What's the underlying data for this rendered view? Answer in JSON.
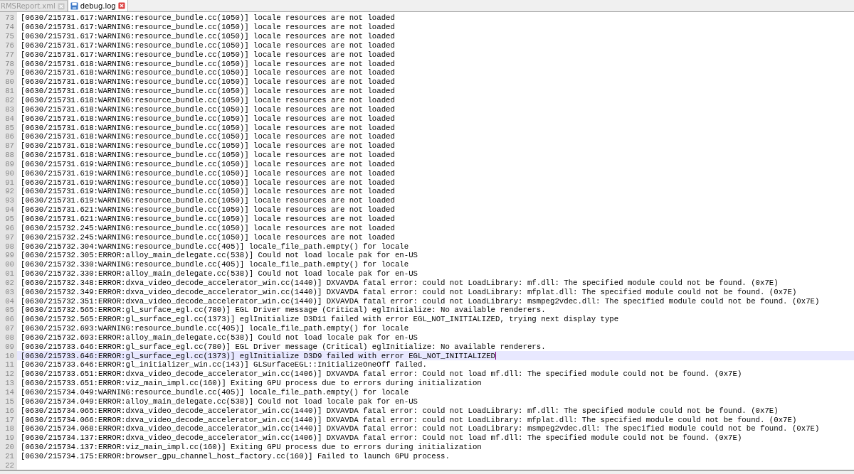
{
  "tabs": [
    {
      "label": "RMSReport.xml",
      "selected": false
    },
    {
      "label": "debug.log",
      "selected": true
    }
  ],
  "editor": {
    "lines": [
      {
        "number": "73",
        "text": "[0630/215731.617:WARNING:resource_bundle.cc(1050)] locale resources are not loaded",
        "current": false
      },
      {
        "number": "74",
        "text": "[0630/215731.617:WARNING:resource_bundle.cc(1050)] locale resources are not loaded",
        "current": false
      },
      {
        "number": "75",
        "text": "[0630/215731.617:WARNING:resource_bundle.cc(1050)] locale resources are not loaded",
        "current": false
      },
      {
        "number": "76",
        "text": "[0630/215731.617:WARNING:resource_bundle.cc(1050)] locale resources are not loaded",
        "current": false
      },
      {
        "number": "77",
        "text": "[0630/215731.617:WARNING:resource_bundle.cc(1050)] locale resources are not loaded",
        "current": false
      },
      {
        "number": "78",
        "text": "[0630/215731.618:WARNING:resource_bundle.cc(1050)] locale resources are not loaded",
        "current": false
      },
      {
        "number": "79",
        "text": "[0630/215731.618:WARNING:resource_bundle.cc(1050)] locale resources are not loaded",
        "current": false
      },
      {
        "number": "80",
        "text": "[0630/215731.618:WARNING:resource_bundle.cc(1050)] locale resources are not loaded",
        "current": false
      },
      {
        "number": "81",
        "text": "[0630/215731.618:WARNING:resource_bundle.cc(1050)] locale resources are not loaded",
        "current": false
      },
      {
        "number": "82",
        "text": "[0630/215731.618:WARNING:resource_bundle.cc(1050)] locale resources are not loaded",
        "current": false
      },
      {
        "number": "83",
        "text": "[0630/215731.618:WARNING:resource_bundle.cc(1050)] locale resources are not loaded",
        "current": false
      },
      {
        "number": "84",
        "text": "[0630/215731.618:WARNING:resource_bundle.cc(1050)] locale resources are not loaded",
        "current": false
      },
      {
        "number": "85",
        "text": "[0630/215731.618:WARNING:resource_bundle.cc(1050)] locale resources are not loaded",
        "current": false
      },
      {
        "number": "86",
        "text": "[0630/215731.618:WARNING:resource_bundle.cc(1050)] locale resources are not loaded",
        "current": false
      },
      {
        "number": "87",
        "text": "[0630/215731.618:WARNING:resource_bundle.cc(1050)] locale resources are not loaded",
        "current": false
      },
      {
        "number": "88",
        "text": "[0630/215731.618:WARNING:resource_bundle.cc(1050)] locale resources are not loaded",
        "current": false
      },
      {
        "number": "89",
        "text": "[0630/215731.619:WARNING:resource_bundle.cc(1050)] locale resources are not loaded",
        "current": false
      },
      {
        "number": "90",
        "text": "[0630/215731.619:WARNING:resource_bundle.cc(1050)] locale resources are not loaded",
        "current": false
      },
      {
        "number": "91",
        "text": "[0630/215731.619:WARNING:resource_bundle.cc(1050)] locale resources are not loaded",
        "current": false
      },
      {
        "number": "92",
        "text": "[0630/215731.619:WARNING:resource_bundle.cc(1050)] locale resources are not loaded",
        "current": false
      },
      {
        "number": "93",
        "text": "[0630/215731.619:WARNING:resource_bundle.cc(1050)] locale resources are not loaded",
        "current": false
      },
      {
        "number": "94",
        "text": "[0630/215731.621:WARNING:resource_bundle.cc(1050)] locale resources are not loaded",
        "current": false
      },
      {
        "number": "95",
        "text": "[0630/215731.621:WARNING:resource_bundle.cc(1050)] locale resources are not loaded",
        "current": false
      },
      {
        "number": "96",
        "text": "[0630/215732.245:WARNING:resource_bundle.cc(1050)] locale resources are not loaded",
        "current": false
      },
      {
        "number": "97",
        "text": "[0630/215732.245:WARNING:resource_bundle.cc(1050)] locale resources are not loaded",
        "current": false
      },
      {
        "number": "98",
        "text": "[0630/215732.304:WARNING:resource_bundle.cc(405)] locale_file_path.empty() for locale",
        "current": false
      },
      {
        "number": "99",
        "text": "[0630/215732.305:ERROR:alloy_main_delegate.cc(538)] Could not load locale pak for en-US",
        "current": false
      },
      {
        "number": "00",
        "text": "[0630/215732.330:WARNING:resource_bundle.cc(405)] locale_file_path.empty() for locale",
        "current": false
      },
      {
        "number": "01",
        "text": "[0630/215732.330:ERROR:alloy_main_delegate.cc(538)] Could not load locale pak for en-US",
        "current": false
      },
      {
        "number": "02",
        "text": "[0630/215732.348:ERROR:dxva_video_decode_accelerator_win.cc(1440)] DXVAVDA fatal error: could not LoadLibrary: mf.dll: The specified module could not be found. (0x7E)",
        "current": false
      },
      {
        "number": "03",
        "text": "[0630/215732.349:ERROR:dxva_video_decode_accelerator_win.cc(1440)] DXVAVDA fatal error: could not LoadLibrary: mfplat.dll: The specified module could not be found. (0x7E)",
        "current": false
      },
      {
        "number": "04",
        "text": "[0630/215732.351:ERROR:dxva_video_decode_accelerator_win.cc(1440)] DXVAVDA fatal error: could not LoadLibrary: msmpeg2vdec.dll: The specified module could not be found. (0x7E)",
        "current": false
      },
      {
        "number": "05",
        "text": "[0630/215732.565:ERROR:gl_surface_egl.cc(780)] EGL Driver message (Critical) eglInitialize: No available renderers.",
        "current": false
      },
      {
        "number": "06",
        "text": "[0630/215732.565:ERROR:gl_surface_egl.cc(1373)] eglInitialize D3D11 failed with error EGL_NOT_INITIALIZED, trying next display type",
        "current": false
      },
      {
        "number": "07",
        "text": "[0630/215732.693:WARNING:resource_bundle.cc(405)] locale_file_path.empty() for locale",
        "current": false
      },
      {
        "number": "08",
        "text": "[0630/215732.693:ERROR:alloy_main_delegate.cc(538)] Could not load locale pak for en-US",
        "current": false
      },
      {
        "number": "09",
        "text": "[0630/215733.646:ERROR:gl_surface_egl.cc(780)] EGL Driver message (Critical) eglInitialize: No available renderers.",
        "current": false
      },
      {
        "number": "10",
        "text": "[0630/215733.646:ERROR:gl_surface_egl.cc(1373)] eglInitialize D3D9 failed with error EGL_NOT_INITIALIZED",
        "current": true
      },
      {
        "number": "11",
        "text": "[0630/215733.646:ERROR:gl_initializer_win.cc(143)] GLSurfaceEGL::InitializeOneOff failed.",
        "current": false
      },
      {
        "number": "12",
        "text": "[0630/215733.651:ERROR:dxva_video_decode_accelerator_win.cc(1406)] DXVAVDA fatal error: Could not load mf.dll: The specified module could not be found. (0x7E)",
        "current": false
      },
      {
        "number": "13",
        "text": "[0630/215733.651:ERROR:viz_main_impl.cc(160)] Exiting GPU process due to errors during initialization",
        "current": false
      },
      {
        "number": "14",
        "text": "[0630/215734.049:WARNING:resource_bundle.cc(405)] locale_file_path.empty() for locale",
        "current": false
      },
      {
        "number": "15",
        "text": "[0630/215734.049:ERROR:alloy_main_delegate.cc(538)] Could not load locale pak for en-US",
        "current": false
      },
      {
        "number": "16",
        "text": "[0630/215734.065:ERROR:dxva_video_decode_accelerator_win.cc(1440)] DXVAVDA fatal error: could not LoadLibrary: mf.dll: The specified module could not be found. (0x7E)",
        "current": false
      },
      {
        "number": "17",
        "text": "[0630/215734.066:ERROR:dxva_video_decode_accelerator_win.cc(1440)] DXVAVDA fatal error: could not LoadLibrary: mfplat.dll: The specified module could not be found. (0x7E)",
        "current": false
      },
      {
        "number": "18",
        "text": "[0630/215734.068:ERROR:dxva_video_decode_accelerator_win.cc(1440)] DXVAVDA fatal error: could not LoadLibrary: msmpeg2vdec.dll: The specified module could not be found. (0x7E)",
        "current": false
      },
      {
        "number": "19",
        "text": "[0630/215734.137:ERROR:dxva_video_decode_accelerator_win.cc(1406)] DXVAVDA fatal error: Could not load mf.dll: The specified module could not be found. (0x7E)",
        "current": false
      },
      {
        "number": "20",
        "text": "[0630/215734.137:ERROR:viz_main_impl.cc(160)] Exiting GPU process due to errors during initialization",
        "current": false
      },
      {
        "number": "21",
        "text": "[0630/215734.175:ERROR:browser_gpu_channel_host_factory.cc(160)] Failed to launch GPU process.",
        "current": false
      },
      {
        "number": "22",
        "current": false
      }
    ]
  }
}
